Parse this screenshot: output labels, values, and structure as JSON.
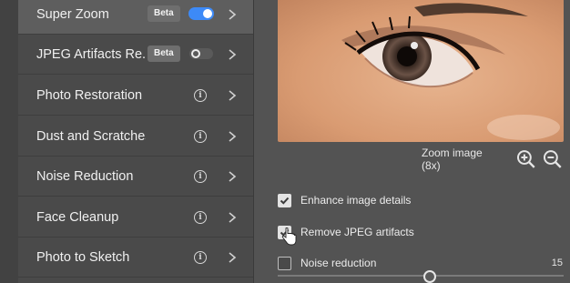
{
  "sidebar": {
    "items": [
      {
        "label": "Super Zoom",
        "badge": "Beta",
        "toggle": "on",
        "active": true
      },
      {
        "label": "JPEG Artifacts Re...",
        "badge": "Beta",
        "toggle": "off"
      },
      {
        "label": "Photo Restoration",
        "icon": "info-icon"
      },
      {
        "label": "Dust and Scratches",
        "icon": "info-icon"
      },
      {
        "label": "Noise Reduction",
        "icon": "info-icon"
      },
      {
        "label": "Face Cleanup",
        "icon": "info-icon"
      },
      {
        "label": "Photo to Sketch",
        "icon": "info-icon"
      }
    ]
  },
  "zoom": {
    "label": "Zoom image (8x)",
    "zoom_in_icon": "zoom-in-icon",
    "zoom_out_icon": "zoom-out-icon"
  },
  "options": {
    "enhance": {
      "label": "Enhance image details",
      "checked": true
    },
    "remove_jpeg": {
      "label": "Remove JPEG artifacts",
      "checked": true
    },
    "noise": {
      "label": "Noise reduction",
      "checked": false,
      "value": "15"
    }
  },
  "colors": {
    "accent": "#3d8af7",
    "panel": "#535353",
    "sidebar": "#4a4a4a"
  }
}
